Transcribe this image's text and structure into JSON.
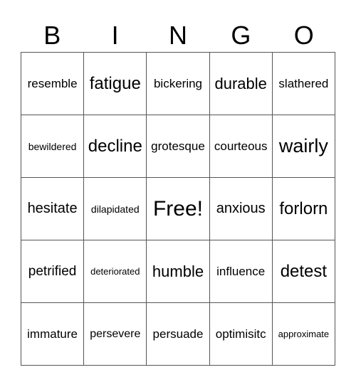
{
  "header": {
    "letters": [
      "B",
      "I",
      "N",
      "G",
      "O"
    ]
  },
  "board": {
    "rows": [
      [
        "resemble",
        "fatigue",
        "bickering",
        "durable",
        "slathered"
      ],
      [
        "bewildered",
        "decline",
        "grotesque",
        "courteous",
        "wairly"
      ],
      [
        "hesitate",
        "dilapidated",
        "Free!",
        "anxious",
        "forlorn"
      ],
      [
        "petrified",
        "deteriorated",
        "humble",
        "influence",
        "detest"
      ],
      [
        "immature",
        "persevere",
        "persuade",
        "optimisitc",
        "approximate"
      ]
    ]
  }
}
